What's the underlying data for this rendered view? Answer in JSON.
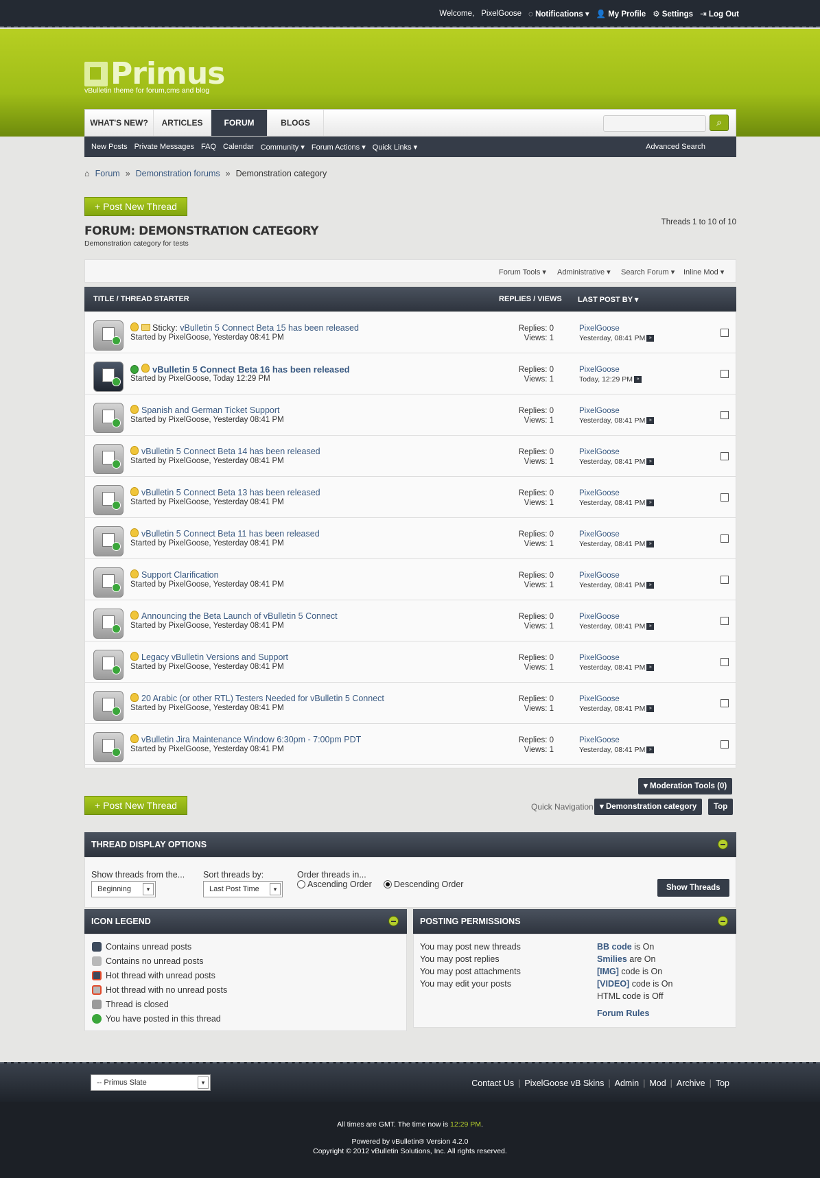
{
  "topbar": {
    "welcome": "Welcome,",
    "user": "PixelGoose",
    "notifications": "Notifications",
    "profile": "My Profile",
    "settings": "Settings",
    "logout": "Log Out"
  },
  "logo": {
    "name": "Primus",
    "tagline": "vBulletin theme for forum,cms and blog"
  },
  "nav": {
    "tabs": [
      "WHAT'S NEW?",
      "ARTICLES",
      "FORUM",
      "BLOGS"
    ],
    "active_tab": "FORUM",
    "search_icon": "search-icon",
    "sub": [
      "New Posts",
      "Private Messages",
      "FAQ",
      "Calendar",
      "Community ▾",
      "Forum Actions ▾",
      "Quick Links ▾"
    ],
    "advanced_search": "Advanced Search"
  },
  "breadcrumb": [
    "Forum",
    "Demonstration forums",
    "Demonstration category"
  ],
  "post_new_thread": "+ Post New Thread",
  "forum": {
    "title": "FORUM: DEMONSTRATION CATEGORY",
    "description": "Demonstration category for tests",
    "page_count": "Threads 1 to 10 of 10"
  },
  "tools": [
    "Forum Tools ▾",
    "Administrative ▾",
    "Search Forum ▾",
    "Inline Mod ▾"
  ],
  "table_header": {
    "title": "TITLE / THREAD STARTER",
    "replies": "REPLIES / VIEWS",
    "lastpost": "LAST POST BY ▾"
  },
  "threads": [
    {
      "prefix": "Sticky:",
      "title": "vBulletin 5 Connect Beta 15 has been released",
      "starter": "Started by PixelGoose, Yesterday 08:41 PM",
      "replies": "Replies: 0",
      "views": "Views: 1",
      "lp_user": "PixelGoose",
      "lp_date": "Yesterday, 08:41 PM"
    },
    {
      "prefix": "",
      "title": "vBulletin 5 Connect Beta 16 has been released",
      "starter": "Started by PixelGoose, Today 12:29 PM",
      "replies": "Replies: 0",
      "views": "Views: 1",
      "lp_user": "PixelGoose",
      "lp_date": "Today, 12:29 PM"
    },
    {
      "prefix": "",
      "title": "Spanish and German Ticket Support",
      "starter": "Started by PixelGoose, Yesterday 08:41 PM",
      "replies": "Replies: 0",
      "views": "Views: 1",
      "lp_user": "PixelGoose",
      "lp_date": "Yesterday, 08:41 PM"
    },
    {
      "prefix": "",
      "title": "vBulletin 5 Connect Beta 14 has been released",
      "starter": "Started by PixelGoose, Yesterday 08:41 PM",
      "replies": "Replies: 0",
      "views": "Views: 1",
      "lp_user": "PixelGoose",
      "lp_date": "Yesterday, 08:41 PM"
    },
    {
      "prefix": "",
      "title": "vBulletin 5 Connect Beta 13 has been released",
      "starter": "Started by PixelGoose, Yesterday 08:41 PM",
      "replies": "Replies: 0",
      "views": "Views: 1",
      "lp_user": "PixelGoose",
      "lp_date": "Yesterday, 08:41 PM"
    },
    {
      "prefix": "",
      "title": "vBulletin 5 Connect Beta 11 has been released",
      "starter": "Started by PixelGoose, Yesterday 08:41 PM",
      "replies": "Replies: 0",
      "views": "Views: 1",
      "lp_user": "PixelGoose",
      "lp_date": "Yesterday, 08:41 PM"
    },
    {
      "prefix": "",
      "title": "Support Clarification",
      "starter": "Started by PixelGoose, Yesterday 08:41 PM",
      "replies": "Replies: 0",
      "views": "Views: 1",
      "lp_user": "PixelGoose",
      "lp_date": "Yesterday, 08:41 PM"
    },
    {
      "prefix": "",
      "title": "Announcing the Beta Launch of vBulletin 5 Connect",
      "starter": "Started by PixelGoose, Yesterday 08:41 PM",
      "replies": "Replies: 0",
      "views": "Views: 1",
      "lp_user": "PixelGoose",
      "lp_date": "Yesterday, 08:41 PM"
    },
    {
      "prefix": "",
      "title": "Legacy vBulletin Versions and Support",
      "starter": "Started by PixelGoose, Yesterday 08:41 PM",
      "replies": "Replies: 0",
      "views": "Views: 1",
      "lp_user": "PixelGoose",
      "lp_date": "Yesterday, 08:41 PM"
    },
    {
      "prefix": "",
      "title": "20 Arabic (or other RTL) Testers Needed for vBulletin 5 Connect",
      "starter": "Started by PixelGoose, Yesterday 08:41 PM",
      "replies": "Replies: 0",
      "views": "Views: 1",
      "lp_user": "PixelGoose",
      "lp_date": "Yesterday, 08:41 PM"
    },
    {
      "prefix": "",
      "title": "vBulletin Jira Maintenance Window 6:30pm - 7:00pm PDT",
      "starter": "Started by PixelGoose, Yesterday 08:41 PM",
      "replies": "Replies: 0",
      "views": "Views: 1",
      "lp_user": "PixelGoose",
      "lp_date": "Yesterday, 08:41 PM"
    }
  ],
  "moderation_tools": "▾ Moderation Tools (0)",
  "quick_nav": {
    "label": "Quick Navigation",
    "selected": "▾ Demonstration category",
    "top": "Top"
  },
  "display_options": {
    "title": "THREAD DISPLAY OPTIONS",
    "from_label": "Show threads from the...",
    "from_value": "Beginning",
    "sort_label": "Sort threads by:",
    "sort_value": "Last Post Time",
    "order_label": "Order threads in...",
    "asc": "Ascending Order",
    "desc": "Descending Order",
    "show_button": "Show Threads"
  },
  "legend": {
    "title": "ICON LEGEND",
    "items": [
      "Contains unread posts",
      "Contains no unread posts",
      "Hot thread with unread posts",
      "Hot thread with no unread posts",
      "Thread is closed",
      "You have posted in this thread"
    ]
  },
  "permissions": {
    "title": "POSTING PERMISSIONS",
    "left": [
      "You may post new threads",
      "You may post replies",
      "You may post attachments",
      "You may edit your posts"
    ],
    "right": [
      {
        "b": "BB code",
        "t": " is On"
      },
      {
        "b": "Smilies",
        "t": " are On"
      },
      {
        "b": "[IMG]",
        "t": " code is On"
      },
      {
        "b": "[VIDEO]",
        "t": " code is On"
      },
      {
        "b": "",
        "t": "HTML code is Off"
      }
    ],
    "rules": "Forum Rules"
  },
  "footer": {
    "style_select": "-- Primus Slate",
    "links": [
      "Contact Us",
      "PixelGoose vB Skins",
      "Admin",
      "Mod",
      "Archive",
      "Top"
    ],
    "time_prefix": "All times are GMT. The time now is ",
    "time": "12:29 PM",
    "time_suffix": ".",
    "powered": "Powered by vBulletin® Version 4.2.0",
    "copyright": "Copyright © 2012 vBulletin Solutions, Inc. All rights reserved."
  }
}
